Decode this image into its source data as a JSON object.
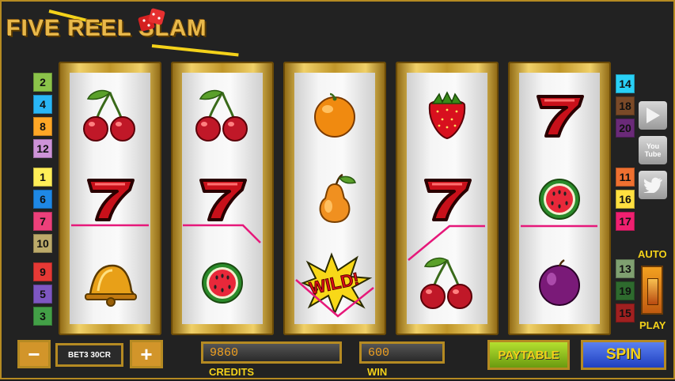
{
  "title": "FIVE REEL SLAM",
  "left_paylines": [
    {
      "label": "2",
      "color": "#8bc34a"
    },
    {
      "label": "4",
      "color": "#29b6f6"
    },
    {
      "label": "8",
      "color": "#ffa726"
    },
    {
      "label": "12",
      "color": "#ce93d8"
    },
    {
      "label": "1",
      "color": "#ffee58"
    },
    {
      "label": "6",
      "color": "#1e88e5"
    },
    {
      "label": "7",
      "color": "#ec407a"
    },
    {
      "label": "10",
      "color": "#bcaa6a"
    },
    {
      "label": "9",
      "color": "#e53935"
    },
    {
      "label": "5",
      "color": "#7e57c2"
    },
    {
      "label": "3",
      "color": "#43a047"
    }
  ],
  "right_paylines": [
    {
      "label": "14",
      "color": "#29d0f6"
    },
    {
      "label": "18",
      "color": "#7a4a28"
    },
    {
      "label": "20",
      "color": "#6a2a78"
    },
    {
      "label": "11",
      "color": "#ef7030"
    },
    {
      "label": "16",
      "color": "#ffe040"
    },
    {
      "label": "17",
      "color": "#ef2070"
    },
    {
      "label": "13",
      "color": "#7fa070"
    },
    {
      "label": "19",
      "color": "#2e6a2e"
    },
    {
      "label": "15",
      "color": "#a02020"
    }
  ],
  "reels": [
    [
      "cherries",
      "seven",
      "bell"
    ],
    [
      "cherries",
      "seven",
      "watermelon"
    ],
    [
      "orange",
      "pear",
      "wild"
    ],
    [
      "strawberry",
      "seven",
      "cherries"
    ],
    [
      "seven",
      "watermelon",
      "plum"
    ]
  ],
  "wild_label": "WILD!",
  "controls": {
    "minus_label": "−",
    "plus_label": "+",
    "bet_text": "BET3 30CR",
    "credits_value": "9860",
    "credits_label": "CREDITS",
    "win_value": "600",
    "win_label": "WIN",
    "paytable_label": "PAYTABLE",
    "spin_label": "SPIN",
    "auto_label": "AUTO",
    "play_label": "PLAY"
  },
  "social": {
    "youtube_label": "You Tube"
  }
}
